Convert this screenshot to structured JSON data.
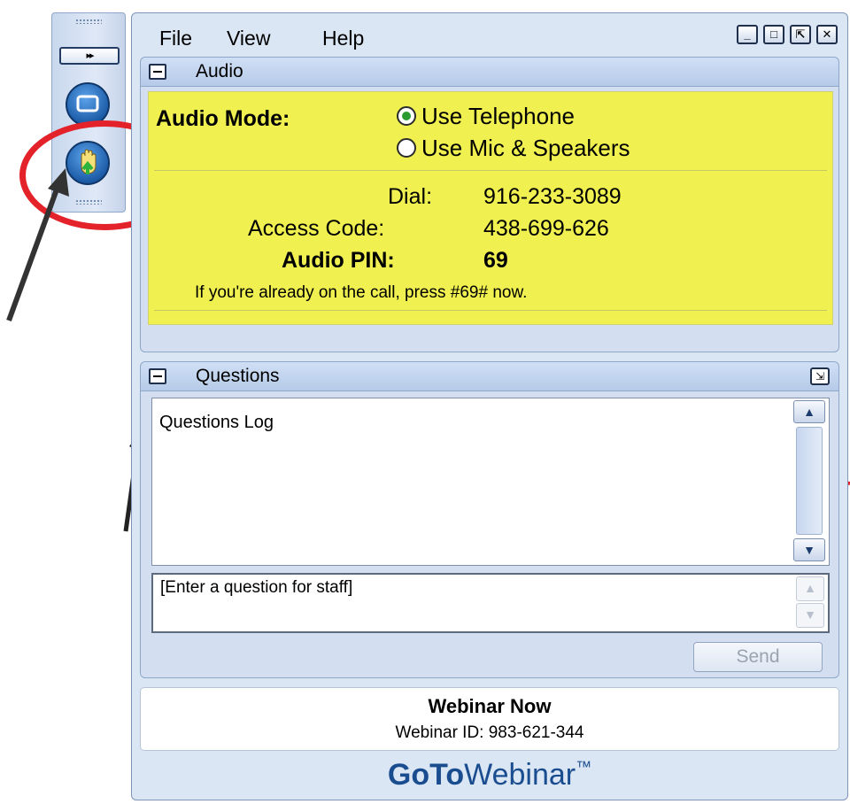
{
  "menu": {
    "file": "File",
    "view": "View",
    "help": "Help"
  },
  "window_buttons": {
    "minimize": "_",
    "restore": "□",
    "popout": "⇱",
    "close": "✕"
  },
  "grabbar": {
    "expand_label": "▸▸"
  },
  "audio": {
    "title": "Audio",
    "mode_label": "Audio Mode:",
    "option_telephone": "Use Telephone",
    "option_mic": "Use Mic & Speakers",
    "selected": "Use Telephone",
    "dial_label": "Dial:",
    "dial_value": "916-233-3089",
    "access_label": "Access Code:",
    "access_value": "438-699-626",
    "pin_label": "Audio PIN:",
    "pin_value": "69",
    "note": "If you're already on the call, press #69# now."
  },
  "questions": {
    "title": "Questions",
    "log_title": "Questions Log",
    "input_placeholder": "[Enter a question for staff]",
    "send_label": "Send"
  },
  "footer": {
    "webinar_name": "Webinar Now",
    "webinar_id": "Webinar ID: 983-621-344",
    "brand_bold": "GoTo",
    "brand_light": "Webinar",
    "brand_tm": "™"
  },
  "colors": {
    "audio_bg": "#f0f050",
    "annotation_red": "#e3222a",
    "panel_bg": "#dbe6f5"
  }
}
